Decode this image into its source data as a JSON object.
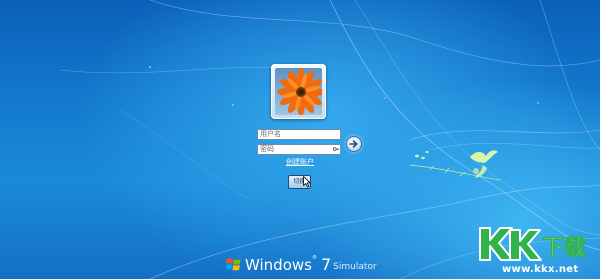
{
  "login": {
    "username_placeholder": "用户名",
    "password_placeholder": "密码",
    "create_account_label": "创建账户",
    "switch_user_label": "切换"
  },
  "brand": {
    "word": "Windows",
    "trademark": "®",
    "version": "7",
    "edition": "Simulator"
  },
  "watermark": {
    "logo_text": "KK下载",
    "url": "www.kkx.net"
  },
  "colors": {
    "desktop_blue": "#1379cc",
    "watermark_green": "#2fb34a",
    "flower_orange": "#f06a0f"
  },
  "icons": [
    "flower-avatar",
    "key-icon",
    "arrow-right-icon",
    "cursor-icon",
    "windows-logo",
    "bird-icon",
    "kk-logo"
  ]
}
